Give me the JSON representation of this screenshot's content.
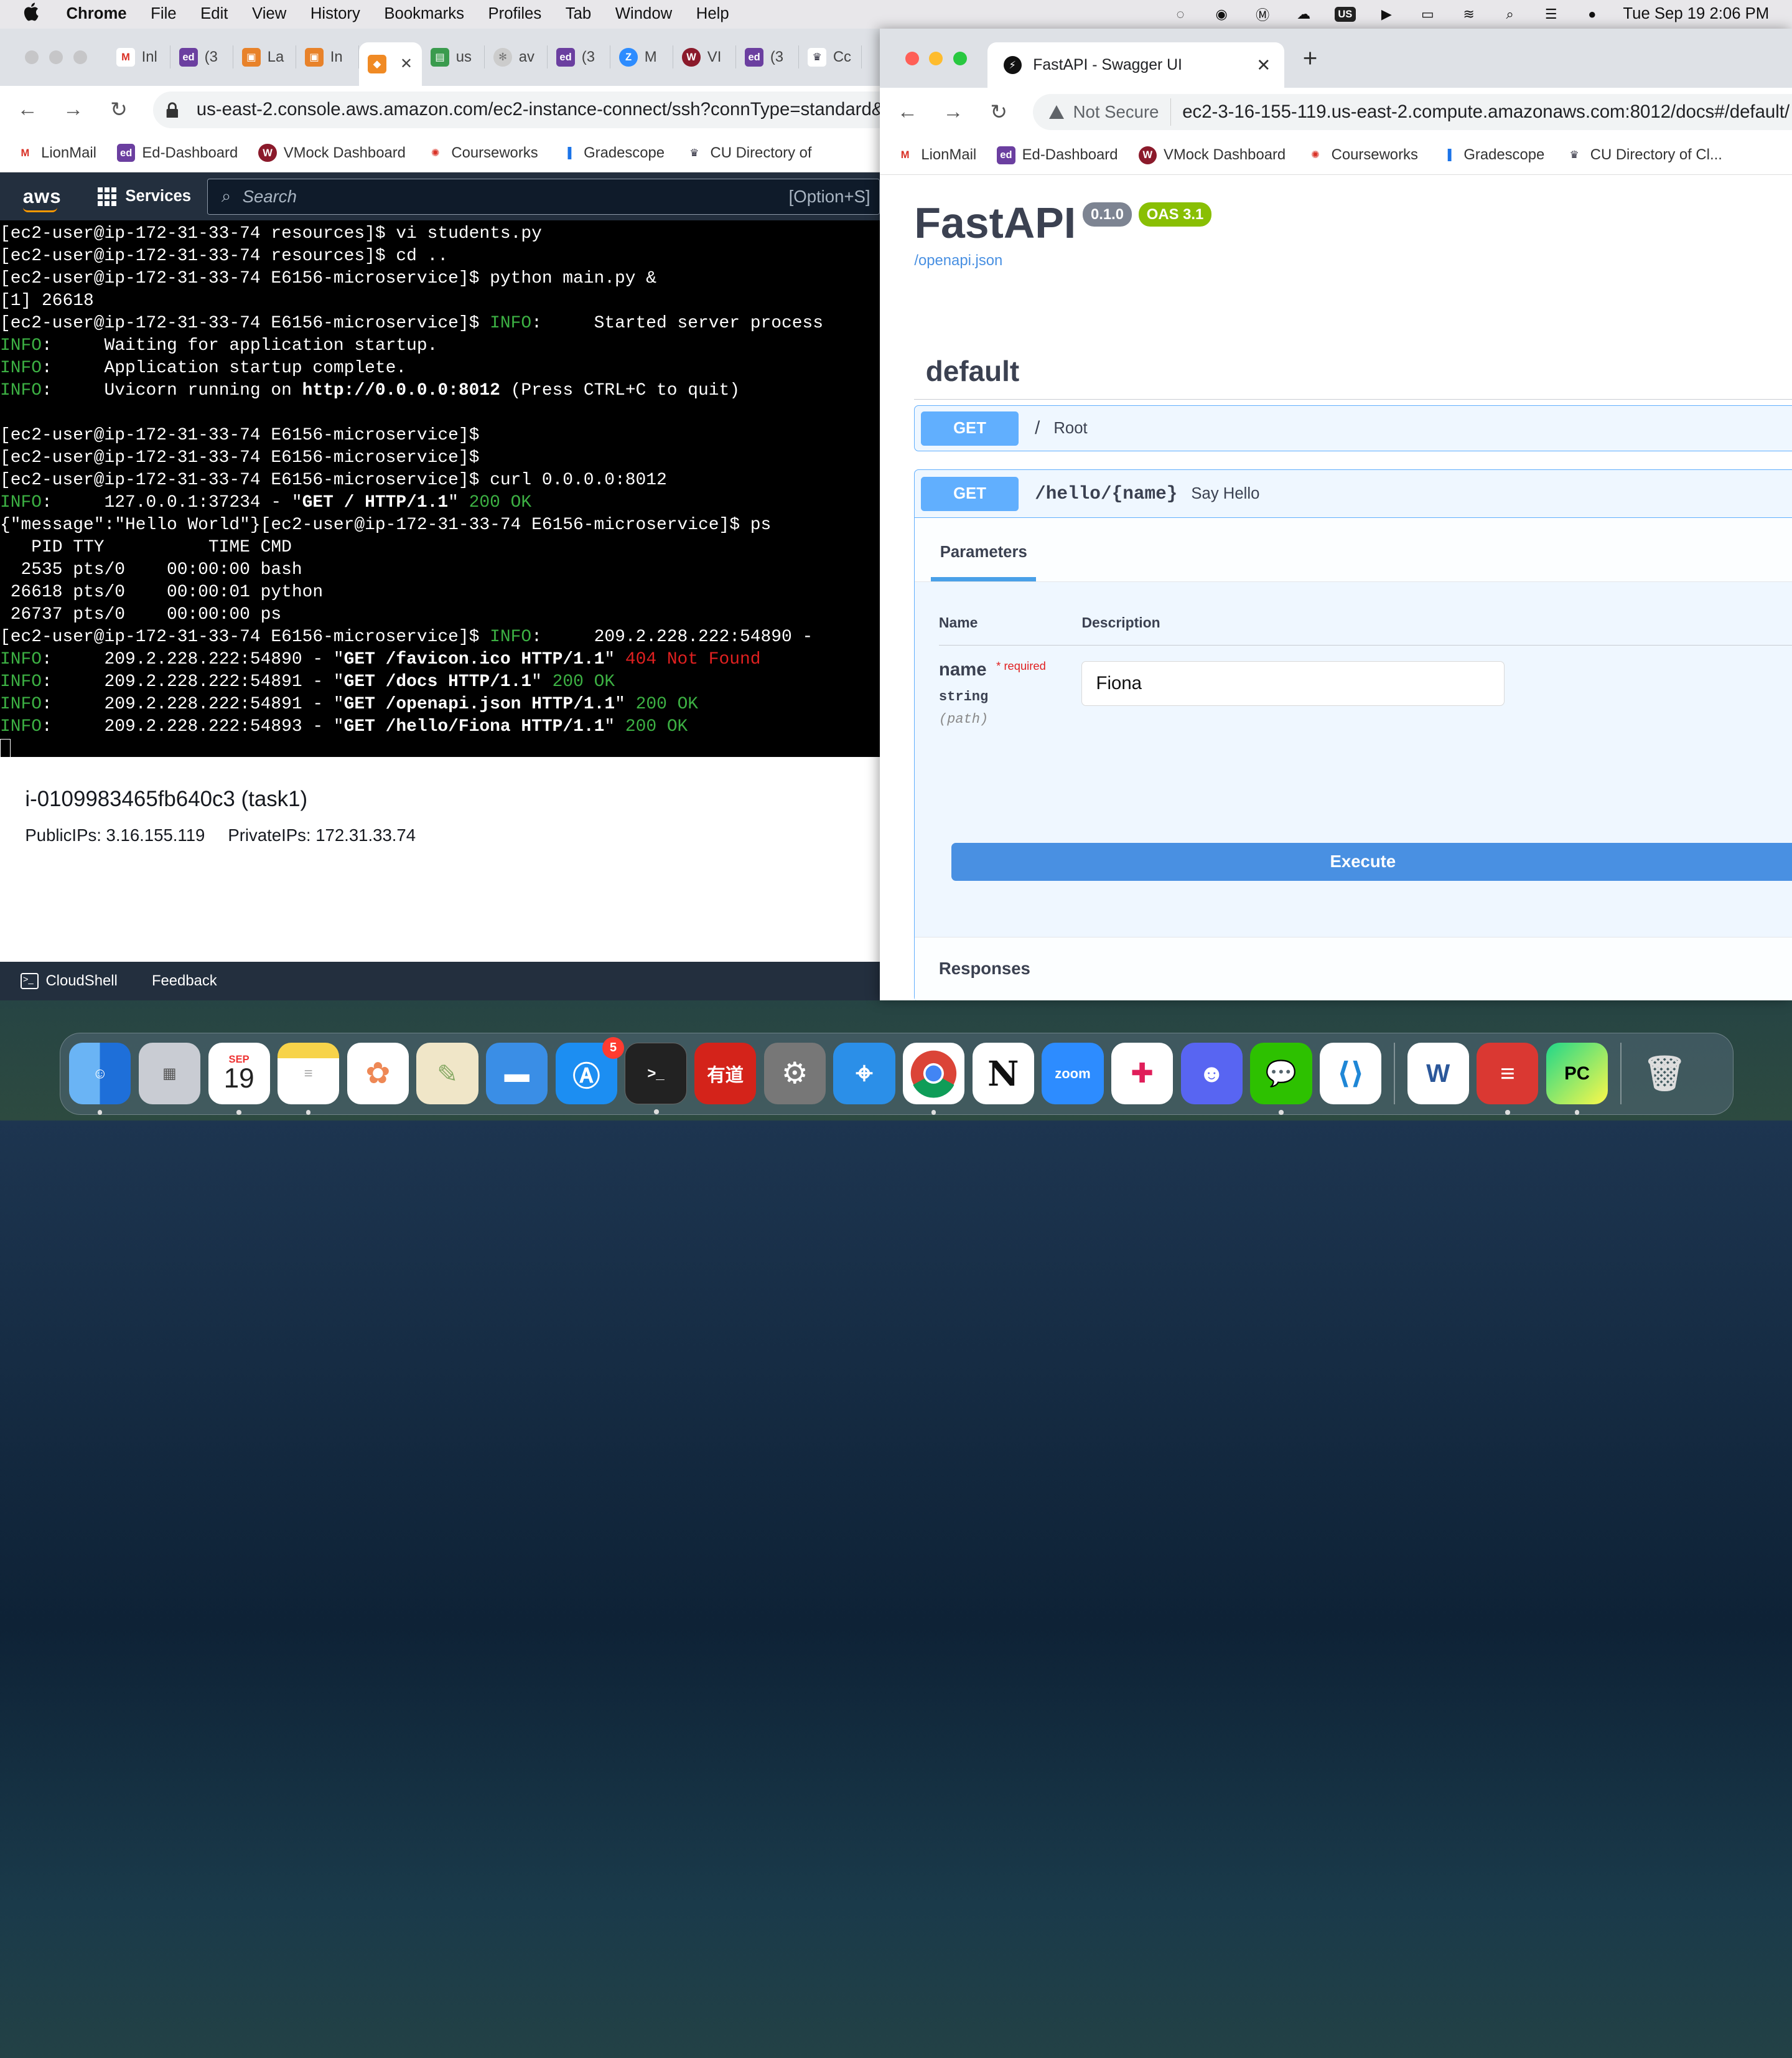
{
  "menubar": {
    "app_name": "Chrome",
    "items": [
      "File",
      "Edit",
      "View",
      "History",
      "Bookmarks",
      "Profiles",
      "Tab",
      "Window",
      "Help"
    ],
    "status_badge": "US",
    "datetime": "Tue Sep 19  2:06 PM"
  },
  "left_browser": {
    "tabs": [
      {
        "label": "Inl",
        "icon": "gmail-icon"
      },
      {
        "label": "(3",
        "icon": "ed-icon"
      },
      {
        "label": "La",
        "icon": "orange-app-icon"
      },
      {
        "label": "In",
        "icon": "orange-app-icon"
      },
      {
        "label": "",
        "icon": "aws-cube-icon"
      },
      {
        "label": "us",
        "icon": "green-app-icon"
      },
      {
        "label": "av",
        "icon": "loading-icon"
      },
      {
        "label": "(3",
        "icon": "ed-icon"
      },
      {
        "label": "M",
        "icon": "zoom-icon"
      },
      {
        "label": "VI",
        "icon": "vmock-icon"
      },
      {
        "label": "(3",
        "icon": "ed-icon"
      },
      {
        "label": "Cc",
        "icon": "crown-icon"
      }
    ],
    "url": "us-east-2.console.aws.amazon.com/ec2-instance-connect/ssh?connType=standard&i",
    "bookmarks": [
      "LionMail",
      "Ed-Dashboard",
      "VMock Dashboard",
      "Courseworks",
      "Gradescope",
      "CU Directory of"
    ],
    "aws": {
      "services_label": "Services",
      "search_placeholder": "Search",
      "search_shortcut": "[Option+S]"
    },
    "instance": {
      "title": "i-0109983465fb640c3 (task1)",
      "public_ips": "PublicIPs: 3.16.155.119",
      "private_ips": "PrivateIPs: 172.31.33.74"
    },
    "footer": {
      "cloudshell": "CloudShell",
      "feedback": "Feedback"
    }
  },
  "terminal": {
    "lines": [
      [
        {
          "t": "[ec2-user@ip-172-31-33-74 resources]$ vi students.py"
        }
      ],
      [
        {
          "t": "[ec2-user@ip-172-31-33-74 resources]$ cd .."
        }
      ],
      [
        {
          "t": "[ec2-user@ip-172-31-33-74 E6156-microservice]$ python main.py &"
        }
      ],
      [
        {
          "t": "[1] 26618"
        }
      ],
      [
        {
          "t": "[ec2-user@ip-172-31-33-74 E6156-microservice]$ "
        },
        {
          "t": "INFO",
          "c": "green"
        },
        {
          "t": ":     Started server process"
        }
      ],
      [
        {
          "t": "INFO",
          "c": "green"
        },
        {
          "t": ":     Waiting for application startup."
        }
      ],
      [
        {
          "t": "INFO",
          "c": "green"
        },
        {
          "t": ":     Application startup complete."
        }
      ],
      [
        {
          "t": "INFO",
          "c": "green"
        },
        {
          "t": ":     Uvicorn running on "
        },
        {
          "t": "http://0.0.0.0:8012",
          "c": "bold"
        },
        {
          "t": " (Press CTRL+C to quit)"
        }
      ],
      [
        {
          "t": ""
        }
      ],
      [
        {
          "t": "[ec2-user@ip-172-31-33-74 E6156-microservice]$"
        }
      ],
      [
        {
          "t": "[ec2-user@ip-172-31-33-74 E6156-microservice]$"
        }
      ],
      [
        {
          "t": "[ec2-user@ip-172-31-33-74 E6156-microservice]$ curl 0.0.0.0:8012"
        }
      ],
      [
        {
          "t": "INFO",
          "c": "green"
        },
        {
          "t": ":     127.0.0.1:37234 - \""
        },
        {
          "t": "GET / HTTP/1.1",
          "c": "bold"
        },
        {
          "t": "\" "
        },
        {
          "t": "200 OK",
          "c": "green"
        }
      ],
      [
        {
          "t": "{\"message\":\"Hello World\"}[ec2-user@ip-172-31-33-74 E6156-microservice]$ ps"
        }
      ],
      [
        {
          "t": "   PID TTY          TIME CMD"
        }
      ],
      [
        {
          "t": "  2535 pts/0    00:00:00 bash"
        }
      ],
      [
        {
          "t": " 26618 pts/0    00:00:01 python"
        }
      ],
      [
        {
          "t": " 26737 pts/0    00:00:00 ps"
        }
      ],
      [
        {
          "t": "[ec2-user@ip-172-31-33-74 E6156-microservice]$ "
        },
        {
          "t": "INFO",
          "c": "green"
        },
        {
          "t": ":     209.2.228.222:54890 - "
        }
      ],
      [
        {
          "t": "INFO",
          "c": "green"
        },
        {
          "t": ":     209.2.228.222:54890 - \""
        },
        {
          "t": "GET /favicon.ico HTTP/1.1",
          "c": "bold"
        },
        {
          "t": "\" "
        },
        {
          "t": "404 Not Found",
          "c": "red"
        }
      ],
      [
        {
          "t": "INFO",
          "c": "green"
        },
        {
          "t": ":     209.2.228.222:54891 - \""
        },
        {
          "t": "GET /docs HTTP/1.1",
          "c": "bold"
        },
        {
          "t": "\" "
        },
        {
          "t": "200 OK",
          "c": "green"
        }
      ],
      [
        {
          "t": "INFO",
          "c": "green"
        },
        {
          "t": ":     209.2.228.222:54891 - \""
        },
        {
          "t": "GET /openapi.json HTTP/1.1",
          "c": "bold"
        },
        {
          "t": "\" "
        },
        {
          "t": "200 OK",
          "c": "green"
        }
      ],
      [
        {
          "t": "INFO",
          "c": "green"
        },
        {
          "t": ":     209.2.228.222:54893 - \""
        },
        {
          "t": "GET /hello/Fiona HTTP/1.1",
          "c": "bold"
        },
        {
          "t": "\" "
        },
        {
          "t": "200 OK",
          "c": "green"
        }
      ]
    ],
    "colors": {
      "green": "#3cb043",
      "red": "#e02020"
    }
  },
  "right_browser": {
    "tab_title": "FastAPI - Swagger UI",
    "security_label": "Not Secure",
    "url": "ec2-3-16-155-119.us-east-2.compute.amazonaws.com:8012/docs#/default/",
    "bookmarks": [
      "LionMail",
      "Ed-Dashboard",
      "VMock Dashboard",
      "Courseworks",
      "Gradescope",
      "CU Directory of Cl..."
    ]
  },
  "swagger": {
    "title": "FastAPI",
    "version_badge": "0.1.0",
    "oas_badge": "OAS 3.1",
    "spec_link": "/openapi.json",
    "tag": "default",
    "operations": [
      {
        "method": "GET",
        "path": "/",
        "summary": "Root"
      },
      {
        "method": "GET",
        "path": "/hello/{name}",
        "summary": "Say Hello"
      }
    ],
    "params_tab": "Parameters",
    "col_name": "Name",
    "col_description": "Description",
    "param": {
      "name": "name",
      "required_mark": "*",
      "required_label": "required",
      "type": "string",
      "in": "(path)",
      "value": "Fiona"
    },
    "execute_label": "Execute",
    "responses_label": "Responses"
  },
  "dock": {
    "calendar_month": "SEP",
    "calendar_day": "19",
    "appstore_badge": "5",
    "zoom_label": "zoom",
    "youdao_label": "有道",
    "word_label": "W",
    "pycharm_label": "PC",
    "terminal_label": ">_",
    "notion_label": "N"
  }
}
